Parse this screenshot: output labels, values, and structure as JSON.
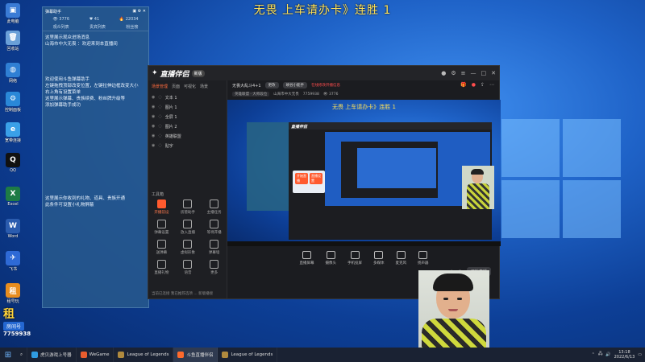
{
  "stream_title": "无畏 上车请办卡》连胜 1",
  "desktop_icons": [
    {
      "label": "此电脑",
      "color": "#3a7bd5",
      "glyph": "▣"
    },
    {
      "label": "回收站",
      "color": "#6aa0d8",
      "glyph": "🗑"
    },
    {
      "label": "网络",
      "color": "#2f7fd4",
      "glyph": "◍"
    },
    {
      "label": "控制面板",
      "color": "#2a88d8",
      "glyph": "⚙"
    },
    {
      "label": "宽带连接",
      "color": "#3aa0e8",
      "glyph": "e"
    },
    {
      "label": "QQ",
      "color": "#111111",
      "glyph": "Q"
    },
    {
      "label": "Excel",
      "color": "#1e7b45",
      "glyph": "X"
    },
    {
      "label": "Word",
      "color": "#2b5cae",
      "glyph": "W"
    },
    {
      "label": "飞书",
      "color": "#2e6ad6",
      "glyph": "✈"
    },
    {
      "label": "租号玩",
      "color": "#e88d1f",
      "glyph": "租"
    }
  ],
  "assistant": {
    "title": "弹幕助手",
    "stats": [
      "3776",
      "41",
      "22034"
    ],
    "tabs": [
      "观众列表",
      "贵宾列表",
      "粉丝榜"
    ],
    "messages": [
      "这里展示观众进场消息",
      "山海市中大无畏 ：欢迎来到本直播间",
      "欢迎使用斗鱼弹幕助手",
      "左键拖拽顶部改变位置，左键拉伸边框改变大小",
      "右上角有设置菜单",
      "这里展示弹幕、贵族续费、粉丝牌升级等",
      "添加弹幕助手成功",
      "这里展示你收到的礼物、道具、贵族开通",
      "此条件可设置小礼物屏蔽"
    ]
  },
  "app": {
    "logo_text": "直播伴侣",
    "version_badge": "新版",
    "scene_tabs": [
      "场景管理",
      "页面",
      "可视化",
      "场景"
    ],
    "sources": [
      "文本 1",
      "图片 1",
      "全屏 1",
      "图片 2",
      "英雄联盟",
      "贴字"
    ],
    "tools_title": "工具箱",
    "tools": [
      {
        "label": "开播前设",
        "hot": true
      },
      {
        "label": "房管助手"
      },
      {
        "label": "主播任务"
      },
      {
        "label": "弹幕设置"
      },
      {
        "label": "放入直播"
      },
      {
        "label": "等待开播"
      },
      {
        "label": "送弹幕"
      },
      {
        "label": "虚拟形象"
      },
      {
        "label": "弹幕墙"
      },
      {
        "label": "直播礼物"
      },
      {
        "label": "语音"
      },
      {
        "label": "更多"
      }
    ],
    "footer": "当前已连接 我已推荐选项  ...  新版播接",
    "room_title": "无畏大乱斗4+1",
    "room_pill": "更改",
    "room_tag": "峡谷小能手",
    "room_warn": "在线修改开播信息",
    "row2_left": "英雄联盟 · 大师段位",
    "row2_name": "山海市中大无畏",
    "row2_id": "7759938",
    "row2_count": "3776",
    "preview_title": "无畏 上车请办卡》连胜 1",
    "popup_buttons": [
      "开始直播",
      "直播设置"
    ],
    "controls": [
      "直播屏幕",
      "摄像头",
      "手机投屏",
      "多媒体",
      "麦克风",
      "扬声器"
    ],
    "start_button": "开始直播"
  },
  "room_badge": {
    "big": "租",
    "label": "房间号",
    "id": "7759938"
  },
  "taskbar": {
    "items": [
      {
        "label": "虎贝游戏上号器",
        "color": "#2f9be0"
      },
      {
        "label": "WeGame",
        "color": "#e85d2e"
      },
      {
        "label": "League of Legends",
        "color": "#b08a3e"
      },
      {
        "label": "斗鱼直播伴侣",
        "color": "#ff6a2c",
        "active": true
      },
      {
        "label": "League of Legends",
        "color": "#b08a3e"
      }
    ],
    "time": "13:18",
    "date": "2022/6/13"
  }
}
